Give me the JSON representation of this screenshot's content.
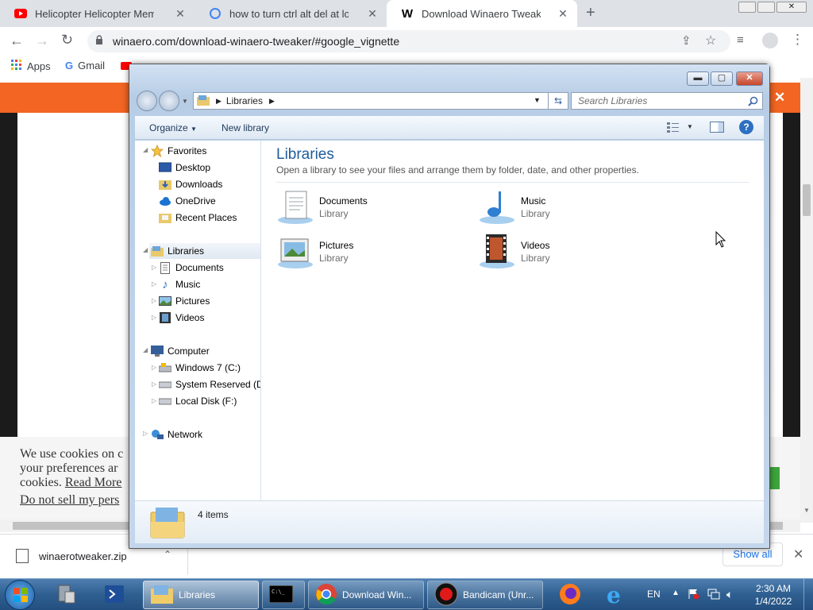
{
  "browser": {
    "tabs": [
      {
        "title": "Helicopter Helicopter Meme TIKT",
        "favicon": "youtube-icon"
      },
      {
        "title": "how to turn ctrl alt del at logon",
        "favicon": "google-icon"
      },
      {
        "title": "Download Winaero Tweaker",
        "favicon": "winaero-icon"
      }
    ],
    "new_tab": "+",
    "url": "winaero.com/download-winaero-tweaker/#google_vignette",
    "bookmarks": [
      {
        "label": "Apps",
        "icon": "apps-grid-icon"
      },
      {
        "label": "Gmail",
        "icon": "google-icon"
      }
    ]
  },
  "page": {
    "cookie_line1": "We use cookies on c",
    "cookie_line2": "your preferences ar",
    "cookie_line3": "cookies.",
    "read_more": "Read More",
    "do_not_sell": "Do not sell my pers",
    "close_x": "×"
  },
  "download": {
    "filename": "winaerotweaker.zip",
    "show_all": "Show all"
  },
  "explorer": {
    "address": "Libraries",
    "search_placeholder": "Search Libraries",
    "organize": "Organize",
    "new_library": "New library",
    "nav": {
      "favorites": "Favorites",
      "favorites_items": [
        "Desktop",
        "Downloads",
        "OneDrive",
        "Recent Places"
      ],
      "libraries": "Libraries",
      "libraries_items": [
        "Documents",
        "Music",
        "Pictures",
        "Videos"
      ],
      "computer": "Computer",
      "computer_items": [
        "Windows 7 (C:)",
        "System Reserved (D:",
        "Local Disk (F:)"
      ],
      "network": "Network"
    },
    "title": "Libraries",
    "subtitle": "Open a library to see your files and arrange them by folder, date, and other properties.",
    "items": [
      {
        "name": "Documents",
        "type": "Library",
        "icon": "documents-library-icon"
      },
      {
        "name": "Music",
        "type": "Library",
        "icon": "music-library-icon"
      },
      {
        "name": "Pictures",
        "type": "Library",
        "icon": "pictures-library-icon"
      },
      {
        "name": "Videos",
        "type": "Library",
        "icon": "videos-library-icon"
      }
    ],
    "count": "4 items"
  },
  "taskbar": {
    "libraries": "Libraries",
    "chrome": "Download Win...",
    "bandicam": "Bandicam (Unr...",
    "lang": "EN",
    "time": "2:30 AM",
    "date": "1/4/2022"
  }
}
